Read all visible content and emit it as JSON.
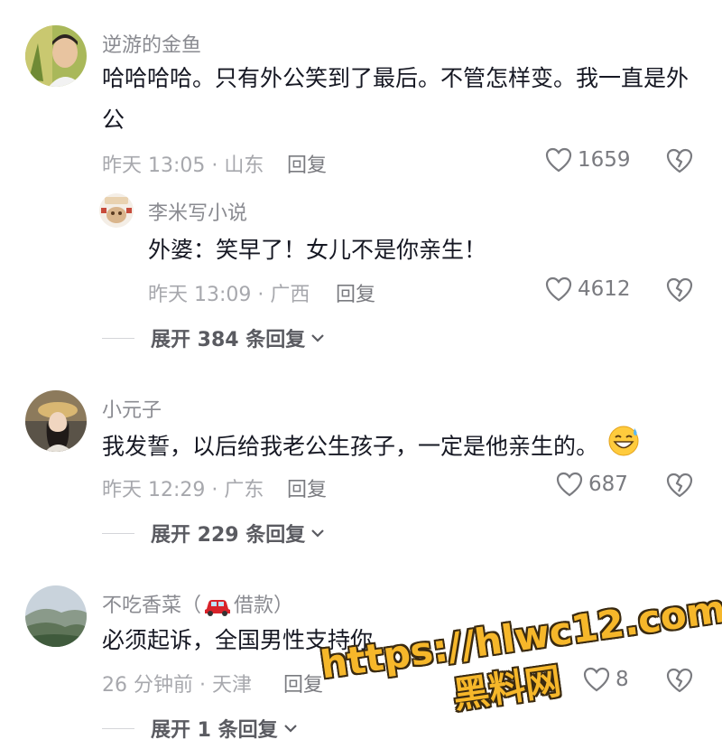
{
  "comments": [
    {
      "username": "逆游的金鱼",
      "text": "哈哈哈哈。只有外公笑到了最后。不管怎样变。我一直是外公",
      "time_location": "昨天 13:05 · 山东",
      "reply_label": "回复",
      "likes": "1659",
      "replies": [
        {
          "username": "李米写小说",
          "text": "外婆：笑早了！女儿不是你亲生！",
          "time_location": "昨天 13:09 · 广西",
          "reply_label": "回复",
          "likes": "4612"
        }
      ],
      "expand_label": "展开 384 条回复"
    },
    {
      "username": "小元子",
      "text": "我发誓，以后给我老公生孩子，一定是他亲生的。",
      "time_location": "昨天 12:29 · 广东",
      "reply_label": "回复",
      "likes": "687",
      "expand_label": "展开 229 条回复"
    },
    {
      "username": "不吃香菜（",
      "username_tag": "借款）",
      "text": "必须起诉，全国男性支持你",
      "time_location": "26 分钟前 · 天津",
      "reply_label": "回复",
      "likes": "8",
      "expand_label": "展开 1 条回复"
    }
  ],
  "watermark": {
    "line1": "https://hlwc12.com",
    "line2": "黑料网"
  },
  "colors": {
    "text": "#161823",
    "muted": "#a7a8ad",
    "watermark": "#f6b72a"
  },
  "icons": [
    "heart-icon",
    "broken-heart-icon",
    "chevron-down-icon",
    "grin-sweat-emoji",
    "car-icon"
  ]
}
